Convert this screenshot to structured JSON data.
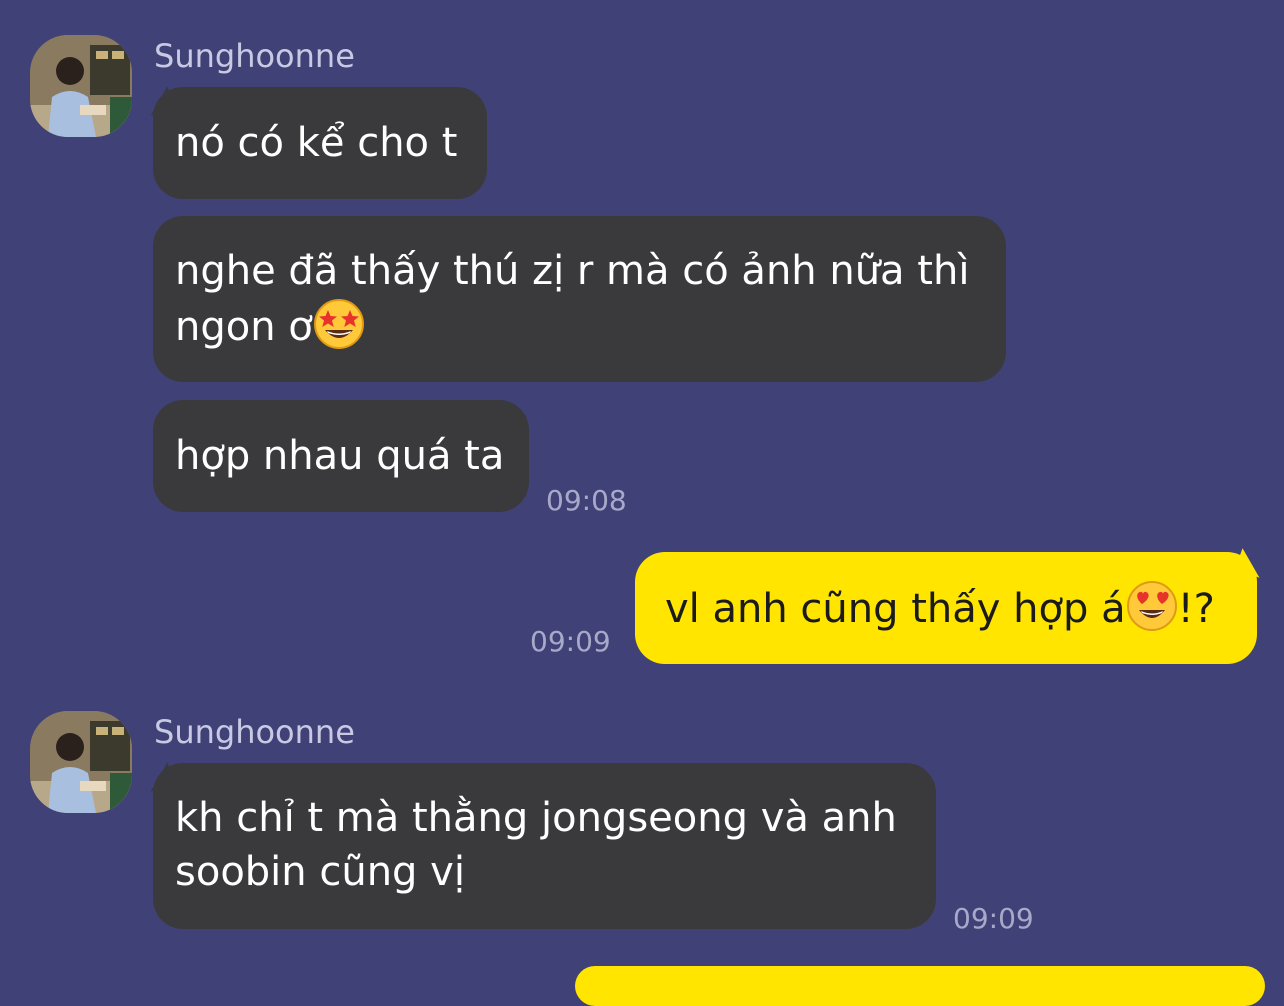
{
  "conversation": {
    "group1": {
      "sender": "Sunghoonne",
      "messages": [
        "nó có kể cho t",
        "nghe đã thấy thú zị r mà có ảnh nữa thì ngon ơ",
        "hợp nhau quá ta"
      ],
      "emoji_in_message2": "star-struck-emoji",
      "time": "09:08"
    },
    "outgoing1": {
      "text_before_emoji": "vl anh cũng thấy hợp á",
      "emoji": "heart-eyes-emoji",
      "text_after_emoji": "!?",
      "time": "09:09"
    },
    "group2": {
      "sender": "Sunghoonne",
      "message": "kh chỉ t mà thằng jongseong và anh soobin cũng vị",
      "time": "09:09"
    }
  },
  "colors": {
    "background": "#404277",
    "incoming_bubble": "#3a3a3c",
    "outgoing_bubble": "#ffe500"
  }
}
